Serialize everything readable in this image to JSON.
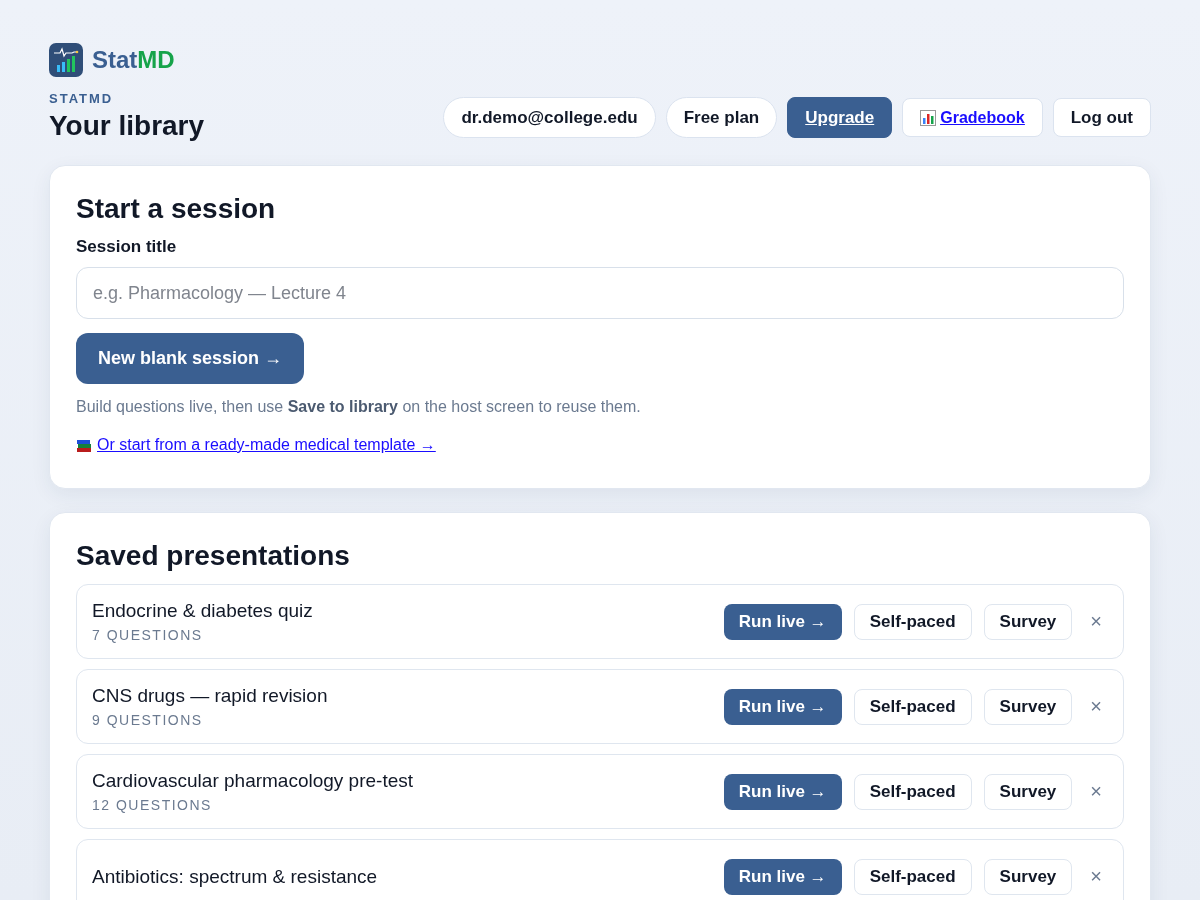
{
  "brand": {
    "name_first": "Stat",
    "name_second": "MD"
  },
  "eyebrow": "STATMD",
  "page_title": "Your library",
  "header_actions": [
    {
      "kind": "pill",
      "label": "dr.demo@college.edu"
    },
    {
      "kind": "pill",
      "label": "Free plan"
    },
    {
      "kind": "primary",
      "label": "Upgrade"
    },
    {
      "kind": "chart-link",
      "label": "Gradebook"
    },
    {
      "kind": "plain",
      "label": "Log out"
    }
  ],
  "start_session": {
    "title": "Start a session",
    "field_label": "Session title",
    "placeholder": "e.g. Pharmacology — Lecture 4",
    "button": "New blank session →",
    "hint": "Build questions live, then use **Save to library** on the host screen to reuse them.",
    "template_link": "Or start from a ready-made medical template →"
  },
  "saved": {
    "title": "Saved presentations",
    "rows": [
      {
        "name": "Endocrine & diabetes quiz",
        "count": "7 QUESTIONS",
        "run": "Run live →",
        "self_paced": "Self-paced",
        "survey": "Survey",
        "remove": "×"
      },
      {
        "name": "CNS drugs — rapid revision",
        "count": "9 QUESTIONS",
        "run": "Run live →",
        "self_paced": "Self-paced",
        "survey": "Survey",
        "remove": "×"
      },
      {
        "name": "Cardiovascular pharmacology pre-test",
        "count": "12 QUESTIONS",
        "run": "Run live →",
        "self_paced": "Self-paced",
        "survey": "Survey",
        "remove": "×"
      },
      {
        "name": "Antibiotics: spectrum & resistance",
        "run": "Run live →",
        "self_paced": "Self-paced",
        "survey": "Survey",
        "remove": "×"
      }
    ]
  }
}
